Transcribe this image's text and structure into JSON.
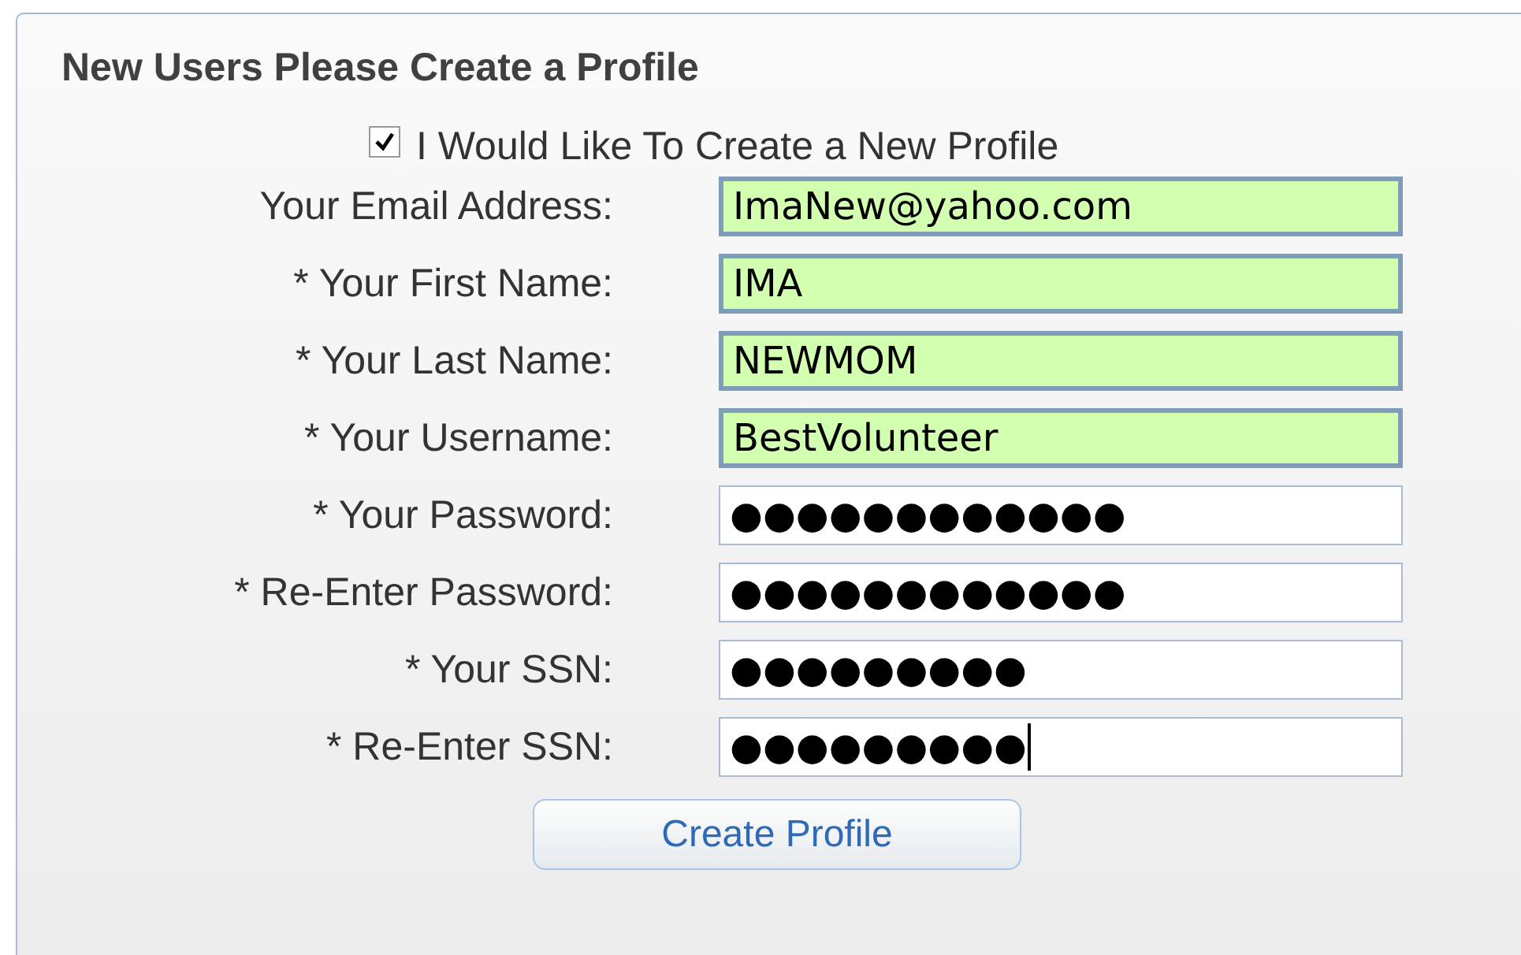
{
  "title": "New Users Please Create a Profile",
  "create_profile_checkbox": {
    "label": "I Would Like To Create a New Profile",
    "checked": true
  },
  "fields": [
    {
      "label": "Your Email Address:",
      "value": "ImaNew@yahoo.com",
      "highlighted": true,
      "focused": false
    },
    {
      "label": "* Your First Name:",
      "value": "IMA",
      "highlighted": true,
      "focused": false
    },
    {
      "label": "* Your Last Name:",
      "value": "NEWMOM",
      "highlighted": true,
      "focused": false
    },
    {
      "label": "* Your Username:",
      "value": "BestVolunteer",
      "highlighted": true,
      "focused": false
    },
    {
      "label": "* Your Password:",
      "value": "●●●●●●●●●●●●",
      "highlighted": false,
      "focused": false
    },
    {
      "label": "* Re-Enter Password:",
      "value": "●●●●●●●●●●●●",
      "highlighted": false,
      "focused": false
    },
    {
      "label": "* Your SSN:",
      "value": "●●●●●●●●●",
      "highlighted": false,
      "focused": false
    },
    {
      "label": "* Re-Enter SSN:",
      "value": "●●●●●●●●●",
      "highlighted": false,
      "focused": true
    }
  ],
  "button": "Create Profile"
}
